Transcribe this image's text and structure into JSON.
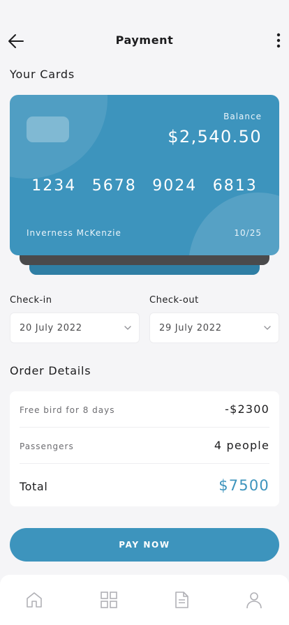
{
  "header": {
    "title": "Payment"
  },
  "cards_section": {
    "title": "Your Cards"
  },
  "card": {
    "balance_label": "Balance",
    "balance": "$2,540.50",
    "number_groups": [
      "1234",
      "5678",
      "9024",
      "6813"
    ],
    "holder": "Inverness McKenzie",
    "expiry": "10/25"
  },
  "checkin": {
    "label": "Check-in",
    "value": "20 July 2022"
  },
  "checkout": {
    "label": "Check-out",
    "value": "29 July 2022"
  },
  "order": {
    "title": "Order Details",
    "rows": [
      {
        "label": "Free bird for 8 days",
        "amount": "-$2300"
      },
      {
        "label": "Passengers",
        "amount": "4 people"
      }
    ],
    "total_label": "Total",
    "total": "$7500"
  },
  "pay_button": {
    "label": "PAY NOW"
  },
  "nav": {
    "items": [
      "home-icon",
      "grid-icon",
      "document-icon",
      "user-icon"
    ]
  },
  "colors": {
    "accent": "#3d94bd",
    "card_shadow": "#4a4a4c"
  }
}
